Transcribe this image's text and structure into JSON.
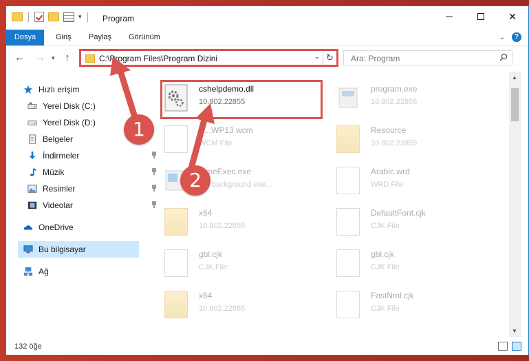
{
  "window": {
    "title": "Program"
  },
  "ribbon": {
    "tabs": [
      "Dosya",
      "Giriş",
      "Paylaş",
      "Görünüm"
    ]
  },
  "address": {
    "path": "C:\\Program Files\\Program Dizini"
  },
  "search": {
    "placeholder": "Ara: Program"
  },
  "sidebar": {
    "items": [
      {
        "label": "Hızlı erişim",
        "icon": "star-icon"
      },
      {
        "label": "Yerel Disk (C:)",
        "icon": "drive-icon"
      },
      {
        "label": "Yerel Disk (D:)",
        "icon": "drive-icon"
      },
      {
        "label": "Belgeler",
        "icon": "documents-icon"
      },
      {
        "label": "İndirmeler",
        "icon": "download-icon"
      },
      {
        "label": "Müzik",
        "icon": "music-icon"
      },
      {
        "label": "Resimler",
        "icon": "pictures-icon"
      },
      {
        "label": "Videolar",
        "icon": "videos-icon"
      },
      {
        "label": "OneDrive",
        "icon": "cloud-icon"
      },
      {
        "label": "Bu bilgisayar",
        "icon": "computer-icon"
      },
      {
        "label": "Ağ",
        "icon": "network-icon"
      }
    ]
  },
  "files": [
    {
      "name": "cshelpdemo.dll",
      "sub": "10.802.22855",
      "type": "dll"
    },
    {
      "name": "program.exe",
      "sub": "10.802.22855",
      "type": "exe"
    },
    {
      "name": "S...WP13.wcm",
      "sub": "WCM File",
      "type": "doc"
    },
    {
      "name": "Resource",
      "sub": "10.802.22855",
      "type": "folder"
    },
    {
      "name": "...meExec.exe",
      "sub": "...T background exe...",
      "type": "exe"
    },
    {
      "name": "Arabic.wrd",
      "sub": "WRD File",
      "type": "doc"
    },
    {
      "name": "x64",
      "sub": "10.802.22855",
      "type": "folder"
    },
    {
      "name": "DefaultFont.cjk",
      "sub": "CJK File",
      "type": "doc"
    },
    {
      "name": "gbl.cjk",
      "sub": "CJK File",
      "type": "doc"
    },
    {
      "name": "gbl.cjk",
      "sub": "CJK File",
      "type": "doc"
    },
    {
      "name": "x64",
      "sub": "10.802.22855",
      "type": "folder"
    },
    {
      "name": "FastNml.cjk",
      "sub": "CJK File",
      "type": "doc"
    }
  ],
  "status": {
    "count": "132 öğe"
  },
  "annotations": {
    "step1": "1",
    "step2": "2",
    "color": "#d9534f"
  }
}
